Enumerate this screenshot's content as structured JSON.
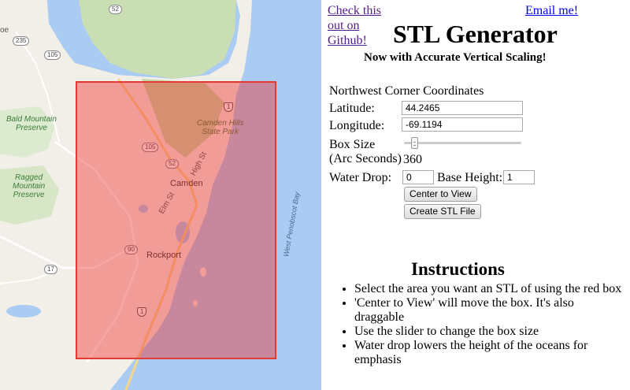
{
  "map": {
    "labels": {
      "bald_mountain": "Bald Mountain\nPreserve",
      "ragged_mountain": "Ragged\nMountain\nPreserve",
      "camden_hills": "Camden Hills\nState Park",
      "camden": "Camden",
      "rockport": "Rockport",
      "elm_st": "Elm St",
      "high_st": "High St",
      "west_penobscot_bay": "West Penobscot Bay",
      "oe": "oe"
    },
    "shields": {
      "r52_top": "52",
      "r235": "235",
      "r105_left": "105",
      "us1_top": "1",
      "r105_mid": "105",
      "r52_mid": "52",
      "r90": "90",
      "r17": "17",
      "us1_bottom": "1"
    }
  },
  "links": {
    "github": "Check this out on Github!",
    "email": "Email me!"
  },
  "header": {
    "title": "STL Generator",
    "subtitle": "Now with Accurate Vertical Scaling!"
  },
  "form": {
    "section_title": "Northwest Corner Coordinates",
    "latitude_label": "Latitude:",
    "latitude_value": "44.2465",
    "longitude_label": "Longitude:",
    "longitude_value": "-69.1194",
    "box_size_label": "Box Size",
    "arc_seconds_label": "(Arc Seconds)",
    "box_size_value": "360",
    "water_drop_label": "Water Drop:",
    "water_drop_value": "0",
    "base_height_label": "Base Height:",
    "base_height_value": "1",
    "center_button": "Center to View",
    "create_button": "Create STL File"
  },
  "instructions": {
    "title": "Instructions",
    "items": [
      "Select the area you want an STL of using the red box",
      "'Center to View' will move the box. It's also draggable",
      "Use the slider to change the box size",
      "Water drop lowers the height of the oceans for emphasis"
    ]
  },
  "colors": {
    "selection_border": "#e53935",
    "land": "#f1efe7",
    "water": "#aacbf2",
    "park": "#c9dfb3"
  }
}
